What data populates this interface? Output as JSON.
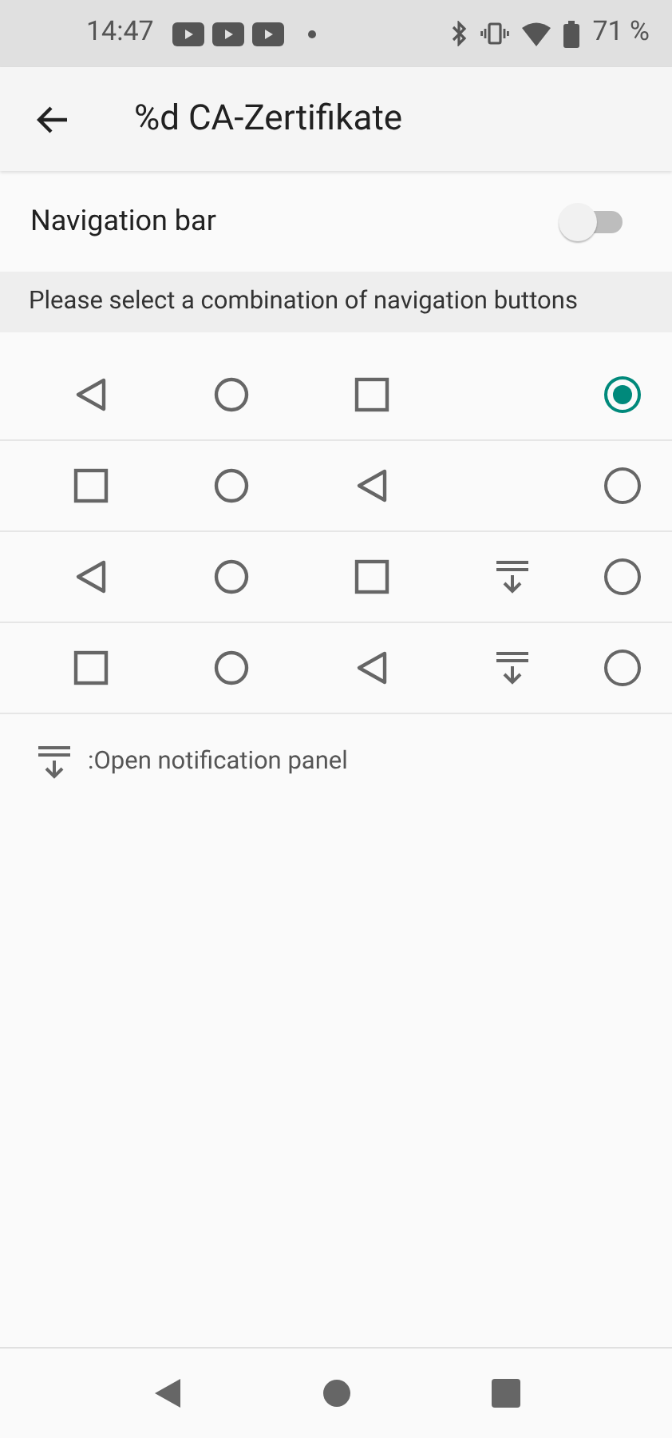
{
  "status_bar": {
    "time": "14:47",
    "battery": "71 %"
  },
  "app_bar": {
    "title": "%d CA-Zertifikate"
  },
  "navigation_bar_setting": {
    "label": "Navigation bar",
    "on": false
  },
  "section_header": "Please select a combination of navigation buttons",
  "combinations": [
    {
      "buttons": [
        {
          "kind": "back"
        },
        {
          "kind": "home"
        },
        {
          "kind": "recents"
        }
      ],
      "selected": true
    },
    {
      "buttons": [
        {
          "kind": "recents"
        },
        {
          "kind": "home"
        },
        {
          "kind": "back"
        }
      ],
      "selected": false
    },
    {
      "buttons": [
        {
          "kind": "back"
        },
        {
          "kind": "home"
        },
        {
          "kind": "recents"
        },
        {
          "kind": "notification"
        }
      ],
      "selected": false
    },
    {
      "buttons": [
        {
          "kind": "recents"
        },
        {
          "kind": "home"
        },
        {
          "kind": "back"
        },
        {
          "kind": "notification"
        }
      ],
      "selected": false
    }
  ],
  "legend": {
    "kind": "notification",
    "text": ":Open notification panel"
  }
}
